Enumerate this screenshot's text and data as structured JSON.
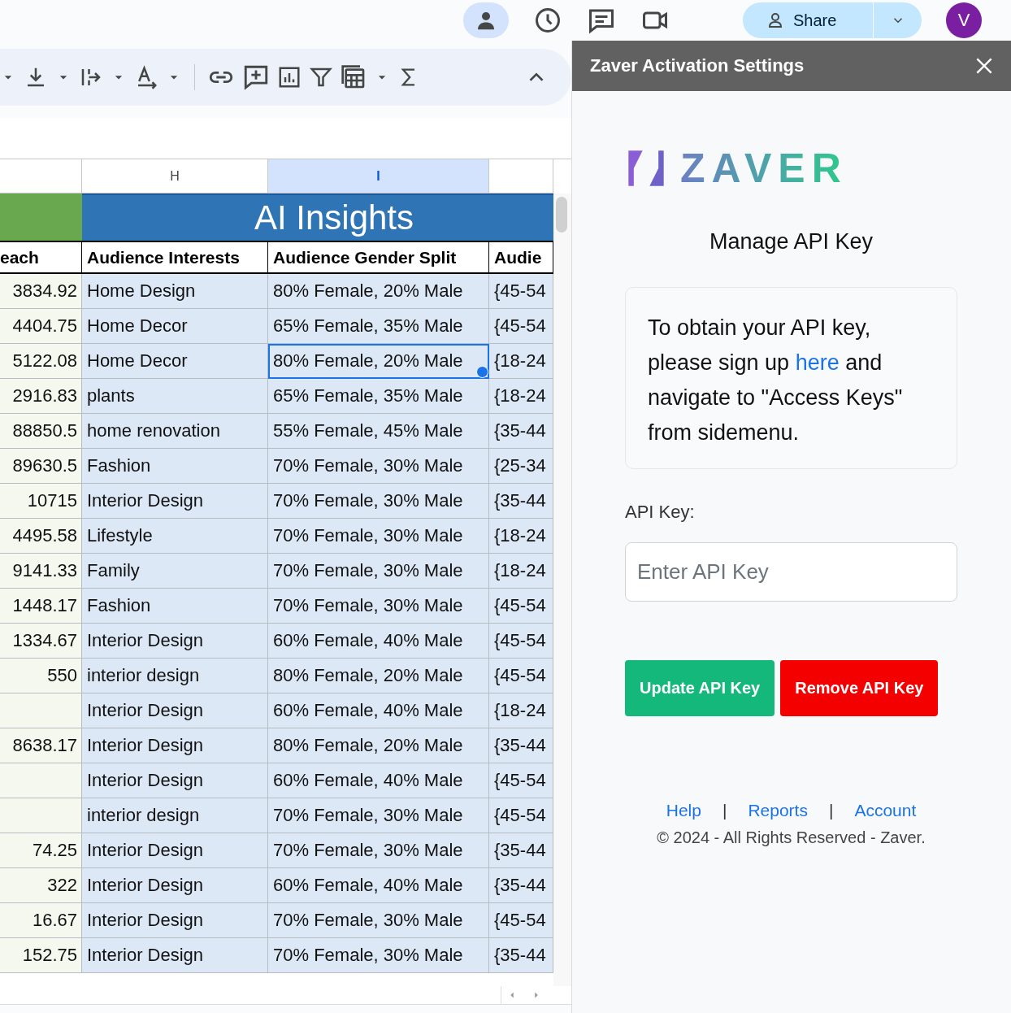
{
  "top_bar": {
    "share_button": "Share",
    "avatar": "V"
  },
  "sheet": {
    "columns": [
      {
        "selected": false
      },
      {
        "letter": "H",
        "selected": false
      },
      {
        "letter": "I",
        "selected": true
      },
      {
        "selected": false
      }
    ],
    "banner": "AI Insights",
    "headers": [
      "each",
      "Audience Interests",
      "Audience Gender Split",
      "Audie"
    ],
    "rows": [
      {
        "reach": "3834.92",
        "interests": "Home Design",
        "gender": "80% Female, 20% Male",
        "column_4": "{45-54",
        "selected": false
      },
      {
        "reach": "4404.75",
        "interests": "Home Decor",
        "gender": "65% Female, 35% Male",
        "column_4": "{45-54",
        "selected": false
      },
      {
        "reach": "5122.08",
        "interests": "Home Decor",
        "gender": "80% Female, 20% Male",
        "column_4": "{18-24",
        "selected": true
      },
      {
        "reach": "2916.83",
        "interests": "plants",
        "gender": "65% Female, 35% Male",
        "column_4": "{18-24",
        "selected": false
      },
      {
        "reach": "88850.5",
        "interests": "home renovation",
        "gender": "55% Female, 45% Male",
        "column_4": "{35-44",
        "selected": false
      },
      {
        "reach": "89630.5",
        "interests": "Fashion",
        "gender": "70% Female, 30% Male",
        "column_4": "{25-34",
        "selected": false
      },
      {
        "reach": "10715",
        "interests": "Interior Design",
        "gender": "70% Female, 30% Male",
        "column_4": "{35-44",
        "selected": false
      },
      {
        "reach": "4495.58",
        "interests": "Lifestyle",
        "gender": "70% Female, 30% Male",
        "column_4": "{18-24",
        "selected": false
      },
      {
        "reach": "9141.33",
        "interests": "Family",
        "gender": "70% Female, 30% Male",
        "column_4": "{18-24",
        "selected": false
      },
      {
        "reach": "1448.17",
        "interests": "Fashion",
        "gender": "70% Female, 30% Male",
        "column_4": "{45-54",
        "selected": false
      },
      {
        "reach": "1334.67",
        "interests": "Interior Design",
        "gender": "60% Female, 40% Male",
        "column_4": "{45-54",
        "selected": false
      },
      {
        "reach": "550",
        "interests": "interior design",
        "gender": "80% Female, 20% Male",
        "column_4": "{45-54",
        "selected": false
      },
      {
        "interests": "Interior Design",
        "gender": "60% Female, 40% Male",
        "column_4": "{18-24",
        "selected": false
      },
      {
        "reach": "8638.17",
        "interests": "Interior Design",
        "gender": "80% Female, 20% Male",
        "column_4": "{35-44",
        "selected": false
      },
      {
        "interests": "Interior Design",
        "gender": "60% Female, 40% Male",
        "column_4": "{45-54",
        "selected": false
      },
      {
        "interests": "interior design",
        "gender": "70% Female, 30% Male",
        "column_4": "{45-54",
        "selected": false
      },
      {
        "reach": "74.25",
        "interests": "Interior Design",
        "gender": "70% Female, 30% Male",
        "column_4": "{35-44",
        "selected": false
      },
      {
        "reach": "322",
        "interests": "Interior Design",
        "gender": "60% Female, 40% Male",
        "column_4": "{35-44",
        "selected": false
      },
      {
        "reach": "16.67",
        "interests": "Interior Design",
        "gender": "70% Female, 30% Male",
        "column_4": "{45-54",
        "selected": false
      },
      {
        "reach": "152.75",
        "interests": "Interior Design",
        "gender": "70% Female, 30% Male",
        "column_4": "{35-44",
        "selected": false
      }
    ]
  },
  "sidebar": {
    "title": "Zaver Activation Settings",
    "logo": "ZAVER",
    "heading": "Manage API Key",
    "info": {
      "before": "To obtain your API key, please sign up ",
      "link": "here",
      "after": " and navigate to \"Access Keys\" from sidemenu."
    },
    "api_label": "API Key:",
    "api_input": {
      "placeholder": "Enter API Key"
    },
    "buttons": [
      {
        "label": "Update API Key",
        "kind": "primary"
      },
      {
        "label": "Remove API Key",
        "kind": "danger"
      }
    ],
    "footer": [
      {
        "kind": "link",
        "text": "Help"
      },
      {
        "kind": "separator",
        "text": "|"
      },
      {
        "kind": "link",
        "text": "Reports"
      },
      {
        "kind": "separator",
        "text": "|"
      },
      {
        "kind": "link",
        "text": "Account"
      }
    ],
    "copyright": "© 2024 - All Rights Reserved - Zaver."
  }
}
